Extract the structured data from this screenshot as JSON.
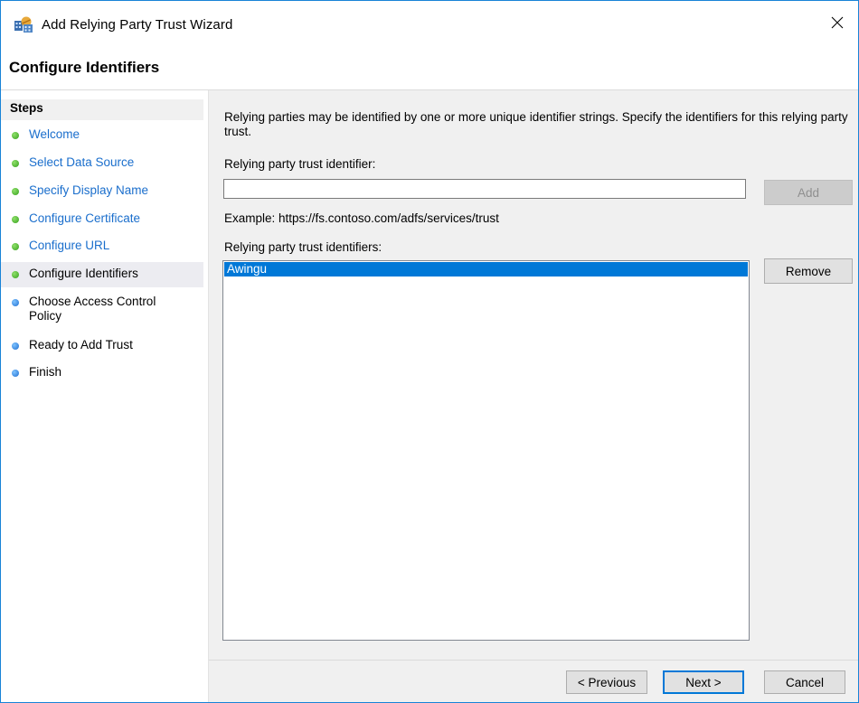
{
  "window": {
    "title": "Add Relying Party Trust Wizard",
    "close_glyph": "✕"
  },
  "page": {
    "title": "Configure Identifiers"
  },
  "steps": {
    "heading": "Steps",
    "items": [
      {
        "label": "Welcome",
        "status": "done"
      },
      {
        "label": "Select Data Source",
        "status": "done"
      },
      {
        "label": "Specify Display Name",
        "status": "done"
      },
      {
        "label": "Configure Certificate",
        "status": "done"
      },
      {
        "label": "Configure URL",
        "status": "done"
      },
      {
        "label": "Configure Identifiers",
        "status": "current"
      },
      {
        "label": "Choose Access Control Policy",
        "status": "pending"
      },
      {
        "label": "Ready to Add Trust",
        "status": "pending"
      },
      {
        "label": "Finish",
        "status": "pending"
      }
    ]
  },
  "content": {
    "description": "Relying parties may be identified by one or more unique identifier strings. Specify the identifiers for this relying party trust.",
    "identifier_label": "Relying party trust identifier:",
    "identifier_value": "",
    "add_button": "Add",
    "example": "Example: https://fs.contoso.com/adfs/services/trust",
    "identifiers_label": "Relying party trust identifiers:",
    "identifiers": [
      "Awingu"
    ],
    "remove_button": "Remove"
  },
  "footer": {
    "previous_button": "< Previous",
    "next_button": "Next >",
    "cancel_button": "Cancel"
  },
  "colors": {
    "accent": "#0078d7",
    "done_dot": "#35a01c",
    "pending_dot": "#1f6fd1",
    "link_text": "#1a6ecc",
    "content_bg": "#f0f0f0"
  }
}
